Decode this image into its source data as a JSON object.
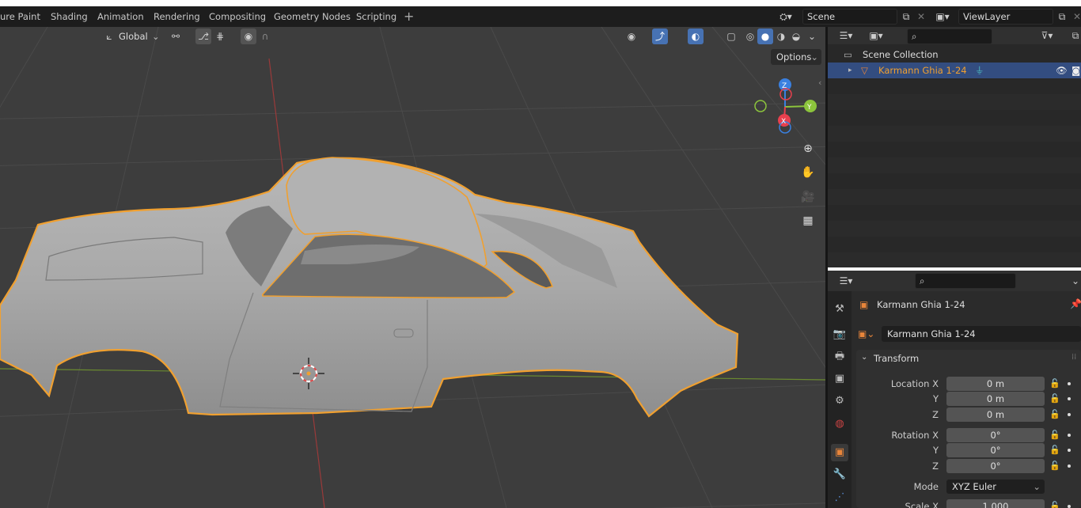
{
  "topbar": {
    "tabs": [
      "ure Paint",
      "Shading",
      "Animation",
      "Rendering",
      "Compositing",
      "Geometry Nodes",
      "Scripting"
    ],
    "add_tab": "+",
    "scene_value": "Scene",
    "viewlayer_value": "ViewLayer"
  },
  "viewport": {
    "transform_orientation": "Global",
    "options_label": "Options",
    "gizmo": {
      "z": "Z",
      "y": "Y",
      "x": "X"
    }
  },
  "outliner": {
    "collection_label": "Scene Collection",
    "object_label": "Karmann Ghia 1-24"
  },
  "properties": {
    "object_name_header": "Karmann Ghia 1-24",
    "object_name_field": "Karmann Ghia 1-24",
    "panel_title": "Transform",
    "location": {
      "label": "Location X",
      "x": "0 m",
      "y_label": "Y",
      "y": "0 m",
      "z_label": "Z",
      "z": "0 m"
    },
    "rotation": {
      "label": "Rotation X",
      "x": "0°",
      "y_label": "Y",
      "y": "0°",
      "z_label": "Z",
      "z": "0°"
    },
    "mode": {
      "label": "Mode",
      "value": "XYZ Euler"
    },
    "scale": {
      "label": "Scale X",
      "x": "1.000"
    }
  },
  "colors": {
    "accent": "#4772b3",
    "selection_outline": "#f0a030",
    "object_orange": "#e8853a",
    "axis_x": "#e8404e",
    "axis_y": "#8cc43c",
    "axis_z": "#3a80e0"
  }
}
